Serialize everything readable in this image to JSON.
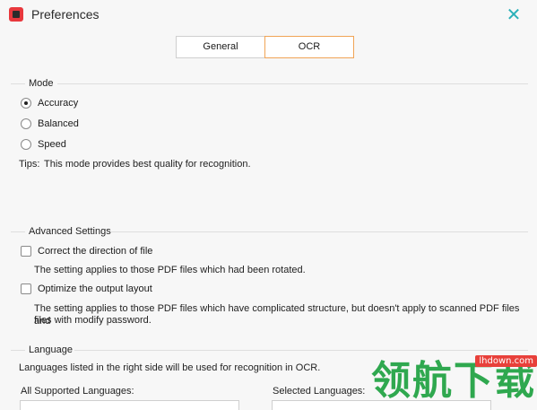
{
  "window": {
    "title": "Preferences",
    "close_glyph": "✕"
  },
  "tabs": [
    {
      "label": "General",
      "active": false
    },
    {
      "label": "OCR",
      "active": true
    }
  ],
  "mode": {
    "title": "Mode",
    "options": [
      {
        "label": "Accuracy",
        "selected": true
      },
      {
        "label": "Balanced",
        "selected": false
      },
      {
        "label": "Speed",
        "selected": false
      }
    ],
    "tips_label": "Tips:",
    "tips_text": "This mode provides best quality for recognition."
  },
  "advanced": {
    "title": "Advanced Settings",
    "correct_direction": {
      "label": "Correct the direction of file",
      "checked": false,
      "description": "The setting applies to those PDF files which had been rotated."
    },
    "optimize_layout": {
      "label": "Optimize the output layout",
      "checked": false,
      "description_line1": "The setting applies to those PDF files which have complicated structure, but doesn't apply to scanned PDF files and",
      "description_line2": "files with modify password."
    }
  },
  "language": {
    "title": "Language",
    "info": "Languages listed in the right side will be used for recognition in OCR.",
    "all_supported_label": "All Supported Languages:",
    "selected_label": "Selected Languages:"
  },
  "watermark": {
    "url": "lhdown.com",
    "text": "领航下载"
  },
  "colors": {
    "accent_close": "#2ab0b8",
    "active_tab_border": "#f0a456",
    "watermark_green": "#2fa84f",
    "watermark_red": "#e8403a"
  },
  "icons": {
    "app": "app-logo-icon",
    "close": "close-icon"
  }
}
